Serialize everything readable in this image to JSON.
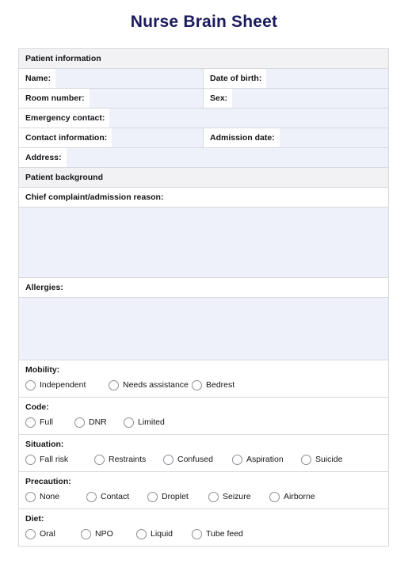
{
  "title": "Nurse Brain Sheet",
  "colors": {
    "title": "#1a1a5e",
    "section_header_bg": "#f2f2f4",
    "field_fill": "#eef0fa",
    "border": "#d8d8de",
    "label_text": "#15151a"
  },
  "sections": {
    "patient_information": {
      "heading": "Patient information",
      "fields": {
        "name": "Name:",
        "date_of_birth": "Date of birth:",
        "room_number": "Room number:",
        "sex": "Sex:",
        "emergency_contact": "Emergency contact:",
        "contact_information": "Contact information:",
        "admission_date": "Admission date:",
        "address": "Address:"
      }
    },
    "patient_background": {
      "heading": "Patient background",
      "chief_complaint_label": "Chief complaint/admission reason:",
      "chief_complaint_value": "",
      "allergies_label": "Allergies:",
      "allergies_value": ""
    },
    "mobility": {
      "label": "Mobility:",
      "options": [
        "Independent",
        "Needs assistance",
        "Bedrest"
      ],
      "selected": ""
    },
    "code": {
      "label": "Code:",
      "options": [
        "Full",
        "DNR",
        "Limited"
      ],
      "selected": ""
    },
    "situation": {
      "label": "Situation:",
      "options": [
        "Fall risk",
        "Restraints",
        "Confused",
        "Aspiration",
        "Suicide"
      ],
      "selected": ""
    },
    "precaution": {
      "label": "Precaution:",
      "options": [
        "None",
        "Contact",
        "Droplet",
        "Seizure",
        "Airborne"
      ],
      "selected": ""
    },
    "diet": {
      "label": "Diet:",
      "options": [
        "Oral",
        "NPO",
        "Liquid",
        "Tube feed"
      ],
      "selected": ""
    }
  }
}
